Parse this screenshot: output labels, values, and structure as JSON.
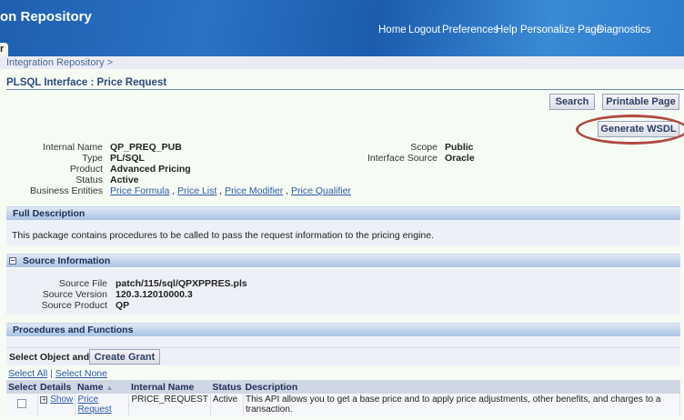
{
  "header": {
    "title": "on Repository",
    "nav": [
      "Home",
      "Logout",
      "Preferences",
      "Help",
      "Personalize Page",
      "Diagnostics"
    ],
    "tab": "r"
  },
  "breadcrumb": "Integration Repository  >",
  "page_title": "PLSQL Interface : Price Request",
  "buttons": {
    "search": "Search",
    "printable": "Printable Page",
    "wsdl": "Generate WSDL"
  },
  "details": {
    "left": [
      {
        "label": "Internal Name",
        "value": "QP_PREQ_PUB"
      },
      {
        "label": "Type",
        "value": "PL/SQL"
      },
      {
        "label": "Product",
        "value": "Advanced Pricing"
      },
      {
        "label": "Status",
        "value": "Active"
      }
    ],
    "business_entities_label": "Business Entities",
    "business_entities": [
      "Price Formula",
      "Price List",
      "Price Modifier",
      "Price Qualifier"
    ],
    "right": [
      {
        "label": "Scope",
        "value": "Public"
      },
      {
        "label": "Interface Source",
        "value": "Oracle"
      }
    ]
  },
  "full_description": {
    "title": "Full Description",
    "text": "This package contains procedures to be called to pass the request information to the pricing engine."
  },
  "source": {
    "title": "Source Information",
    "rows": [
      {
        "label": "Source File",
        "value": "patch/115/sql/QPXPPRES.pls"
      },
      {
        "label": "Source Version",
        "value": "120.3.12010000.3"
      },
      {
        "label": "Source Product",
        "value": "QP"
      }
    ]
  },
  "procedures": {
    "title": "Procedures and Functions",
    "select_object": "Select Object and",
    "create_grant": "Create Grant",
    "select_all": "Select All",
    "select_none": "Select None",
    "columns": [
      "Select",
      "Details",
      "Name",
      "Internal Name",
      "Status",
      "Description"
    ],
    "rows": [
      {
        "details": "Show",
        "name": "Price Request",
        "internal_name": "PRICE_REQUEST",
        "status": "Active",
        "description": "This API allows you to get a base price and to apply price adjustments, other benefits, and charges to a transaction."
      }
    ]
  }
}
